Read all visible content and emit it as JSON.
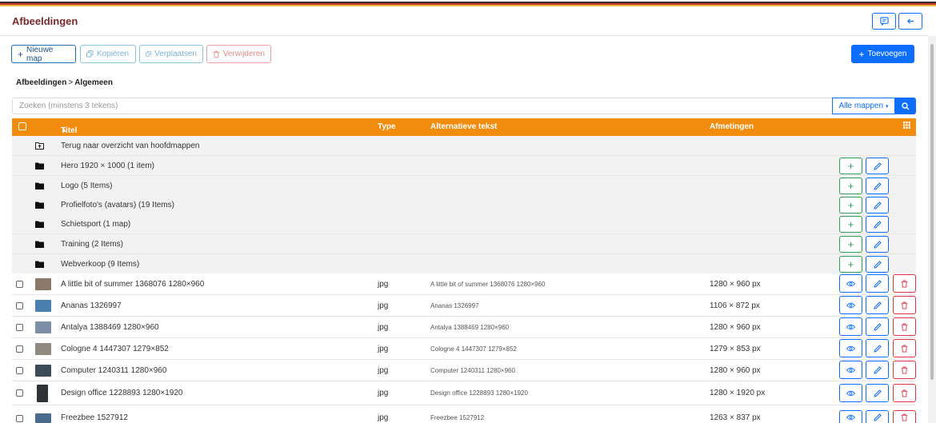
{
  "header": {
    "title": "Afbeeldingen",
    "chat_icon": "chat-icon",
    "back_icon": "arrow-left-icon"
  },
  "toolbar": {
    "new_folder": "Nieuwe map",
    "copy": "Kopiëren",
    "move": "Verplaatsen",
    "delete": "Verwijderen",
    "add": "Toevoegen"
  },
  "breadcrumb": {
    "root": "Afbeeldingen",
    "separator": ">",
    "current": "Algemeen"
  },
  "search": {
    "placeholder": "Zoeken (minstens 3 tekens)",
    "folder_filter": "Alle mappen"
  },
  "table": {
    "columns": {
      "title": "Titel",
      "type": "Type",
      "alt": "Alternatieve tekst",
      "dimensions": "Afmetingen"
    },
    "back_row": "Terug naar overzicht van hoofdmappen",
    "folders": [
      "Hero 1920 × 1000 (1 item)",
      "Logo (5 Items)",
      "Profielfoto's (avatars) (19 Items)",
      "Schietsport (1 map)",
      "Training (2 Items)",
      "Webverkoop (9 Items)"
    ],
    "files": [
      {
        "title": "A little bit of summer 1368076 1280×960",
        "type": "jpg",
        "alt": "A little bit of summer 1368076 1280×960",
        "dimensions": "1280 × 960 px",
        "thumb": "#8a7868"
      },
      {
        "title": "Ananas 1326997",
        "type": "jpg",
        "alt": "Ananas 1326997",
        "dimensions": "1106 × 872 px",
        "thumb": "#4a7fb0"
      },
      {
        "title": "Antalya 1388469 1280×960",
        "type": "jpg",
        "alt": "Antalya 1388469 1280×960",
        "dimensions": "1280 × 960 px",
        "thumb": "#7d8fa6"
      },
      {
        "title": "Cologne 4 1447307 1279×852",
        "type": "jpg",
        "alt": "Cologne 4 1447307 1279×852",
        "dimensions": "1279 × 853 px",
        "thumb": "#8f8a80"
      },
      {
        "title": "Computer 1240311 1280×960",
        "type": "jpg",
        "alt": "Computer 1240311 1280×960",
        "dimensions": "1280 × 960 px",
        "thumb": "#3d4a57"
      },
      {
        "title": "Design office 1228893 1280×1920",
        "type": "jpg",
        "alt": "Design office 1228893 1280×1920",
        "dimensions": "1280 × 1920 px",
        "thumb": "#2f3338"
      },
      {
        "title": "Freezbee 1527912",
        "type": "jpg",
        "alt": "Freezbee 1527912",
        "dimensions": "1263 × 837 px",
        "thumb": "#4a6b8c"
      }
    ]
  },
  "colors": {
    "header_orange": "#f28c0f",
    "primary": "#0d6efd",
    "title_color": "#7a2a2a",
    "danger": "#dc3545",
    "success": "#2e9e5b"
  }
}
